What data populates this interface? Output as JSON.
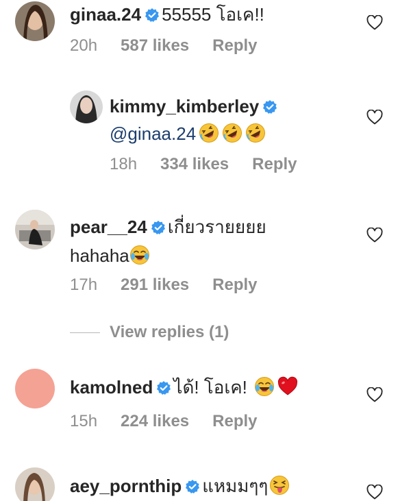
{
  "comments": [
    {
      "username": "ginaa.24",
      "text": "55555 โอเค!!",
      "time": "20h",
      "likes": "587 likes",
      "reply": "Reply",
      "avatar": "avatar-photo-woman"
    },
    {
      "username": "kimmy_kimberley",
      "mention": "@ginaa.24",
      "emoji": [
        "rolling-laughing-emoji",
        "rolling-laughing-emoji",
        "rolling-laughing-emoji"
      ],
      "time": "18h",
      "likes": "334 likes",
      "reply": "Reply",
      "avatar": "avatar-photo-woman"
    },
    {
      "username": "pear__24",
      "text": "เกี่ยวรายยยย",
      "text2": "hahaha",
      "emoji": [
        "tears-of-joy-emoji"
      ],
      "time": "17h",
      "likes": "291 likes",
      "reply": "Reply",
      "avatar": "avatar-photo-woman"
    },
    {
      "username": "kamolned",
      "text": "ได้! โอเค!",
      "emoji": [
        "tears-of-joy-emoji",
        "red-heart-emoji"
      ],
      "time": "15h",
      "likes": "224 likes",
      "reply": "Reply",
      "avatar": "avatar-placeholder-salmon"
    },
    {
      "username": "aey_pornthip",
      "text": "แหมมๆๆ",
      "emoji": [
        "tongue-squint-emoji"
      ],
      "avatar": "avatar-photo-woman"
    }
  ],
  "view_replies": "View replies (1)",
  "colors": {
    "verified": "#3897f0",
    "meta": "#8e8e8e",
    "mention": "#1c3e6e",
    "avatar_placeholder": "#f4a294",
    "heart_emoji": "#e0101f",
    "emoji_face": "#f7c53a"
  }
}
